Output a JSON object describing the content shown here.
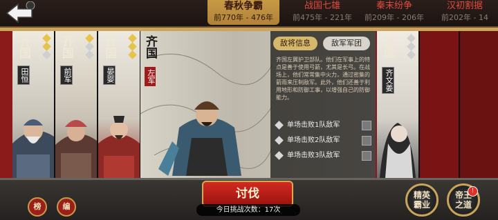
{
  "header": {
    "back_icon": "back-arrow-icon",
    "eras": [
      {
        "name": "春秋争霸",
        "years": "前770年 - 476年"
      },
      {
        "name": "战国七雄",
        "years": "前475年 - 221年"
      },
      {
        "name": "秦末纷争",
        "years": "前209年 - 206年"
      },
      {
        "name": "汉初割据",
        "years": "前202年 - 14"
      }
    ]
  },
  "cards": [
    {
      "nation": "齐国",
      "role": "田恒"
    },
    {
      "nation": "齐国",
      "role": "前军"
    },
    {
      "nation": "齐国",
      "role": "晏婴"
    },
    {
      "nation": "齐国",
      "role": "齐文姜"
    }
  ],
  "main": {
    "nation": "齐国",
    "role": "左军",
    "tabs": {
      "enemy_info": "敌将信息",
      "enemy_army": "敌军军团"
    },
    "description": "齐国左翼护卫部队。他们在军事上的特点是善于使用弓箭，尤其是长弓。在战场上，他们常常集中火力，通过密集的箭雨来压制敌军。此外，他们还善于利用地形和防御工事，以增强自己的防御能力。",
    "tasks": [
      "单场击败1队敌军",
      "单场击败2队敌军",
      "单场击败3队敌军"
    ]
  },
  "bottom": {
    "bang": "榜",
    "bian": "编",
    "fight": "讨伐",
    "count_text": "今日挑战次数：17次",
    "elite": "精英霸业",
    "emperor": "帝王之道",
    "badge": "!"
  },
  "colors": {
    "accent_red": "#9a1410",
    "gold": "#c9a45a",
    "era_red": "#e24b3d"
  }
}
